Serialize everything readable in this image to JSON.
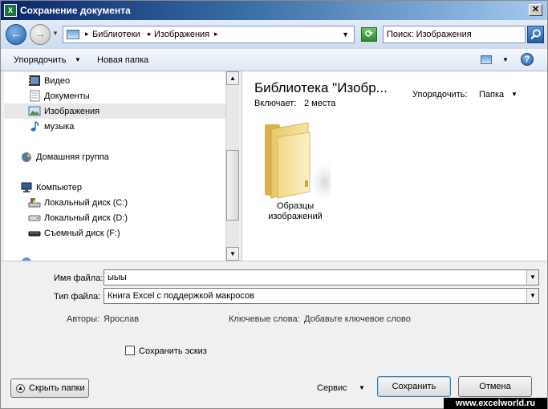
{
  "window": {
    "title": "Сохранение документа",
    "app_icon_label": "X"
  },
  "address": {
    "breadcrumbs": [
      "Библиотеки",
      "Изображения"
    ],
    "search_value": "Поиск: Изображения"
  },
  "toolbar": {
    "organize_label": "Упорядочить",
    "new_folder_label": "Новая папка"
  },
  "nav": {
    "items": [
      {
        "label": "Видео",
        "icon": "video-icon"
      },
      {
        "label": "Документы",
        "icon": "documents-icon"
      },
      {
        "label": "Изображения",
        "icon": "pictures-icon",
        "selected": true
      },
      {
        "label": "музыка",
        "icon": "music-icon"
      },
      {
        "label": "Домашняя группа",
        "icon": "homegroup-icon"
      },
      {
        "label": "Компьютер",
        "icon": "computer-icon"
      },
      {
        "label": "Локальный диск (C:)",
        "icon": "drive-c-icon"
      },
      {
        "label": "Локальный диск (D:)",
        "icon": "drive-d-icon"
      },
      {
        "label": "Съемный диск (F:)",
        "icon": "removable-drive-icon"
      }
    ]
  },
  "content": {
    "library_title": "Библиотека \"Изобр...",
    "includes_label": "Включает:",
    "includes_value": "2 места",
    "arrange_label": "Упорядочить:",
    "arrange_value": "Папка",
    "folders": [
      {
        "line1": "Образцы",
        "line2": "изображений"
      }
    ]
  },
  "form": {
    "filename_label": "Имя файла:",
    "filename_value": "ыыы",
    "filetype_label": "Тип файла:",
    "filetype_value": "Книга Excel с поддержкой макросов",
    "authors_label": "Авторы:",
    "authors_value": "Ярослав",
    "keywords_label": "Ключевые слова:",
    "keywords_value": "Добавьте ключевое слово",
    "thumbnail_label": "Сохранить эскиз",
    "thumbnail_checked": false
  },
  "buttons": {
    "hide_folders": "Скрыть папки",
    "tools": "Сервис",
    "save": "Сохранить",
    "cancel": "Отмена"
  },
  "watermark": "www.excelworld.ru"
}
